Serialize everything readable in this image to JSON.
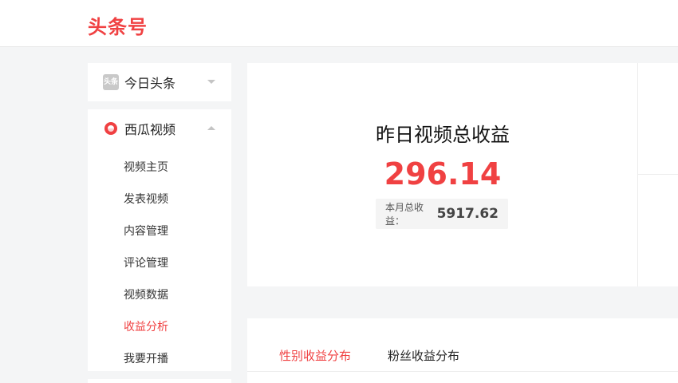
{
  "header": {
    "logo": "头条号"
  },
  "sidebar": {
    "toutiao": {
      "icon": "toutiao-logo-icon",
      "icon_text": "头条",
      "label": "今日头条"
    },
    "xigua": {
      "icon": "xigua-logo-icon",
      "label": "西瓜视频",
      "items": [
        {
          "label": "视频主页"
        },
        {
          "label": "发表视频"
        },
        {
          "label": "内容管理"
        },
        {
          "label": "评论管理"
        },
        {
          "label": "视频数据"
        },
        {
          "label": "收益分析",
          "active": true
        },
        {
          "label": "我要开播"
        }
      ]
    }
  },
  "summary": {
    "title": "昨日视频总收益",
    "value": "296.14",
    "month_label": "本月总收益：",
    "month_value": "5917.62"
  },
  "tabs": [
    {
      "label": "性别收益分布",
      "active": true
    },
    {
      "label": "粉丝收益分布"
    }
  ],
  "colors": {
    "accent": "#f04142",
    "background": "#f4f5f6",
    "panel": "#ffffff"
  }
}
